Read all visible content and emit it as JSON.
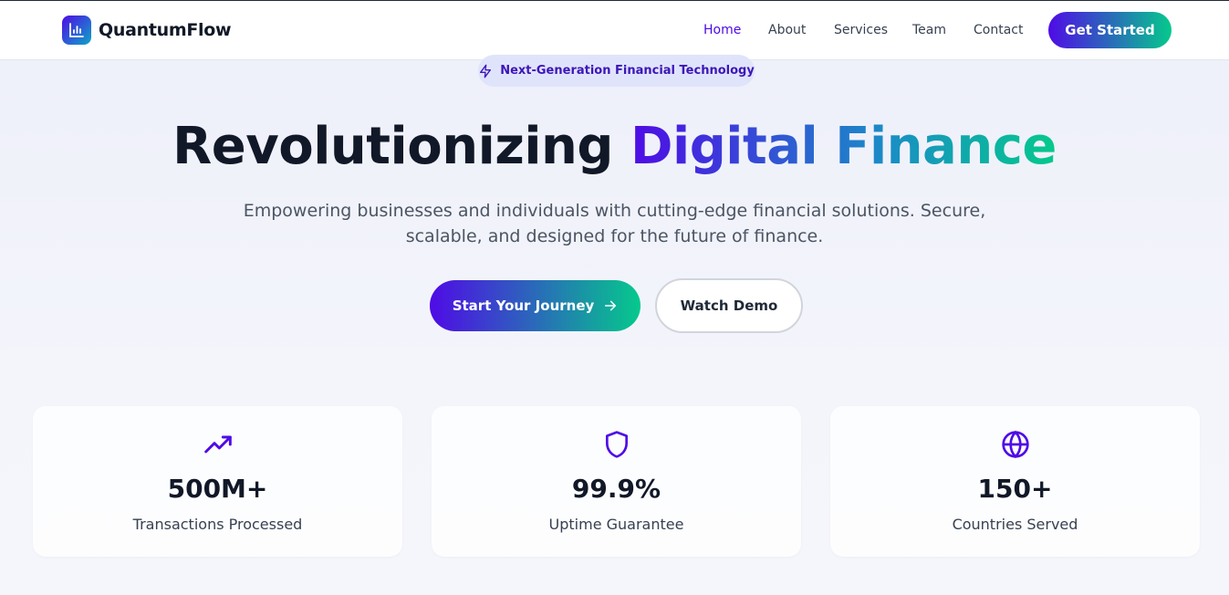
{
  "brand": {
    "name": "QuantumFlow",
    "logo_icon": "bar-chart-icon"
  },
  "nav": {
    "items": [
      {
        "label": "Home",
        "active": true
      },
      {
        "label": "About",
        "active": false
      },
      {
        "label": "Services",
        "active": false
      },
      {
        "label": "Team",
        "active": false
      },
      {
        "label": "Contact",
        "active": false
      }
    ],
    "cta_label": "Get Started"
  },
  "hero": {
    "badge": {
      "icon": "lightning-icon",
      "text": "Next-Generation Financial Technology"
    },
    "title_plain": "Revolutionizing ",
    "title_highlight": "Digital Finance",
    "subtitle_line1": "Empowering businesses and individuals with cutting-edge financial solutions. Secure,",
    "subtitle_line2": "scalable, and designed for the future of finance.",
    "primary_button": {
      "label": "Start Your Journey",
      "icon": "arrow-right-icon"
    },
    "secondary_button": {
      "label": "Watch Demo"
    }
  },
  "stats": [
    {
      "icon": "trending-up-icon",
      "value": "500M+",
      "label": "Transactions Processed"
    },
    {
      "icon": "shield-icon",
      "value": "99.9%",
      "label": "Uptime Guarantee"
    },
    {
      "icon": "globe-icon",
      "value": "150+",
      "label": "Countries Served"
    }
  ],
  "colors": {
    "accent": "#4f0be6",
    "accent_end": "#05c98c",
    "badge_bg": "#e0e4fb",
    "heading": "#111827"
  }
}
